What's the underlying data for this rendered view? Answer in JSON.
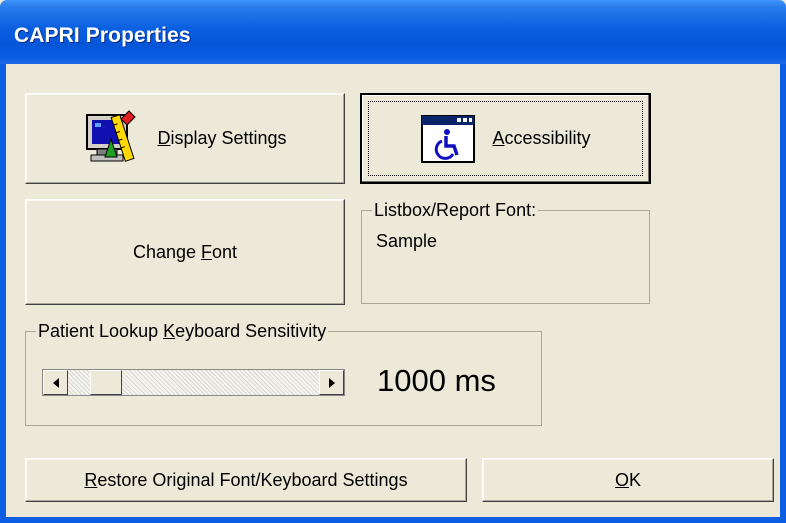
{
  "window": {
    "title": "CAPRI Properties"
  },
  "buttons": {
    "display_settings": {
      "label_pre": "",
      "label_key": "D",
      "label_post": "isplay Settings",
      "icon": "monitor-ruler-icon"
    },
    "accessibility": {
      "label_pre": "",
      "label_key": "A",
      "label_post": "ccessibility",
      "icon": "wheelchair-icon"
    },
    "change_font": {
      "label_pre": "Change ",
      "label_key": "F",
      "label_post": "ont"
    },
    "restore": {
      "label_pre": "",
      "label_key": "R",
      "label_post": "estore Original Font/Keyboard Settings"
    },
    "ok": {
      "label_pre": "",
      "label_key": "O",
      "label_post": "K"
    }
  },
  "font_group": {
    "label": "Listbox/Report Font:",
    "sample_text": "Sample"
  },
  "sensitivity_group": {
    "label_pre": "Patient Lookup ",
    "label_key": "K",
    "label_post": "eyboard Sensitivity",
    "value_text": "1000 ms",
    "slider_value_fraction": 0.1
  },
  "colors": {
    "title_bar": "#0555d8",
    "face": "#ece9d8",
    "accent": "#0b5ee2"
  }
}
